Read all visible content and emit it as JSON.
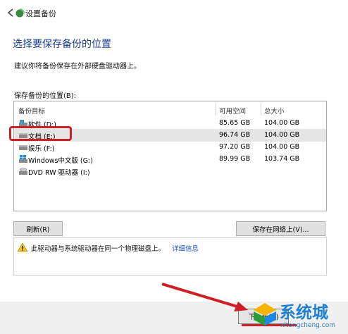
{
  "window": {
    "title": "设置备份"
  },
  "main": {
    "heading": "选择要保存备份的位置",
    "description": "建议你将备份保存在外部硬盘驱动器上。",
    "location_label": "保存备份的位置(B):"
  },
  "table": {
    "headers": [
      "备份目标",
      "可用空间",
      "总大小"
    ],
    "rows": [
      {
        "name": "软件 (D:)",
        "free": "85.65 GB",
        "total": "104.00 GB",
        "icon": "drive-icon"
      },
      {
        "name": "文档 (E:)",
        "free": "96.74 GB",
        "total": "104.00 GB",
        "icon": "drive-icon"
      },
      {
        "name": "娱乐 (F:)",
        "free": "97.20 GB",
        "total": "104.00 GB",
        "icon": "drive-icon"
      },
      {
        "name": "Windows中文版 (G:)",
        "free": "89.99 GB",
        "total": "103.74 GB",
        "icon": "windows-drive-icon"
      },
      {
        "name": "DVD RW 驱动器 (I:)",
        "free": "",
        "total": "",
        "icon": "dvd-drive-icon"
      }
    ]
  },
  "buttons": {
    "refresh": "刷新(R)",
    "save_network": "保存在网络上(V)...",
    "next": "下一步(N)"
  },
  "warning": {
    "text": "此驱动器与系统驱动器在同一个物理磁盘上。",
    "link": "详细信息"
  },
  "watermark": {
    "text": "系统城",
    "url": "xitongcheng.com"
  },
  "colors": {
    "heading": "#1a3d8f",
    "highlight": "#cc1f26",
    "link": "#1a52b5",
    "selection": "#e5e5e5"
  }
}
